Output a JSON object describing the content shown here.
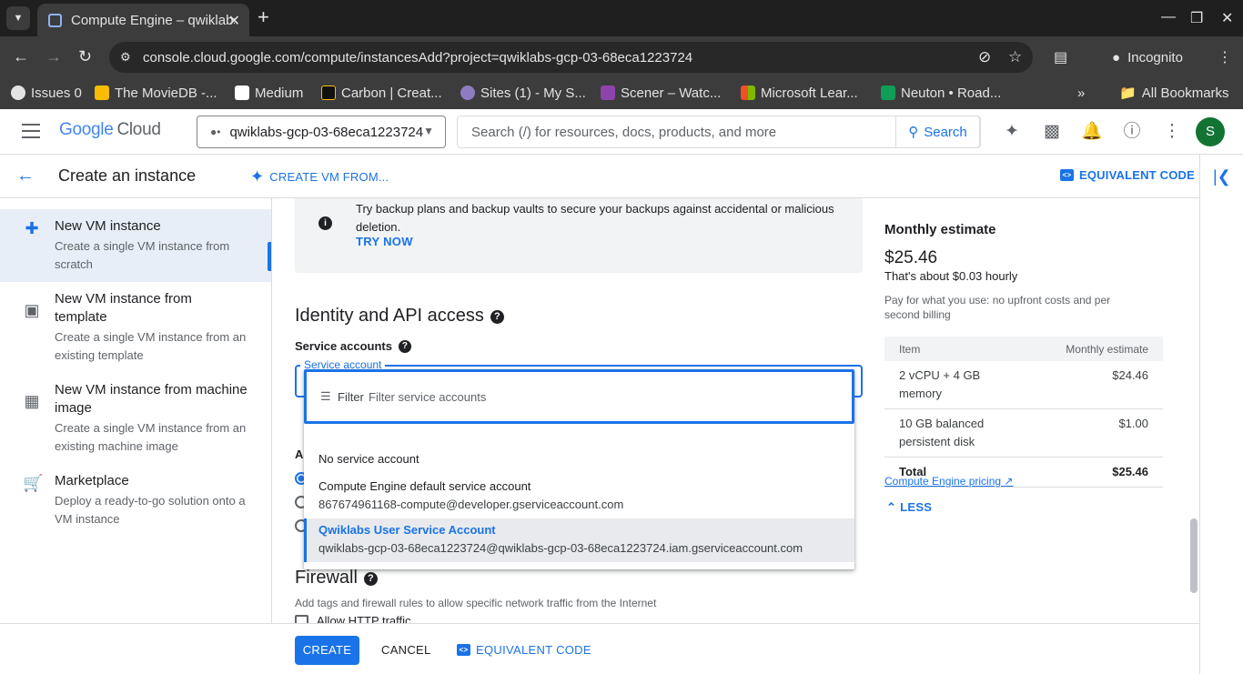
{
  "browser": {
    "tab_title": "Compute Engine – qwiklabs",
    "url": "console.cloud.google.com/compute/instancesAdd?project=qwiklabs-gcp-03-68eca1223724",
    "incognito_label": "Incognito",
    "bookmarks": [
      {
        "label": "Issues 0",
        "color": "#e3e3e3"
      },
      {
        "label": "The MovieDB -...",
        "color": "#fbbc04"
      },
      {
        "label": "Medium",
        "color": "#ffffff"
      },
      {
        "label": "Carbon | Creat...",
        "color": "#222222"
      },
      {
        "label": "Sites (1) - My S...",
        "color": "#8e7cc3"
      },
      {
        "label": "Scener – Watc...",
        "color": "#8e44ad"
      },
      {
        "label": "Microsoft Lear...",
        "color": "#f25022"
      },
      {
        "label": "Neuton • Road...",
        "color": "#0f9d58"
      }
    ],
    "all_bookmarks": "All Bookmarks"
  },
  "header": {
    "logo_google": "Google",
    "logo_cloud": "Cloud",
    "project": "qwiklabs-gcp-03-68eca1223724",
    "search_placeholder": "Search (/) for resources, docs, products, and more",
    "search_button": "Search",
    "avatar_initial": "S"
  },
  "subheader": {
    "title": "Create an instance",
    "create_from": "CREATE VM FROM...",
    "equivalent_code": "EQUIVALENT CODE"
  },
  "nav": [
    {
      "title": "New VM instance",
      "desc": "Create a single VM instance from scratch",
      "icon": "plus-square-icon",
      "active": true
    },
    {
      "title": "New VM instance from template",
      "desc": "Create a single VM instance from an existing template",
      "icon": "template-icon",
      "active": false
    },
    {
      "title": "New VM instance from machine image",
      "desc": "Create a single VM instance from an existing machine image",
      "icon": "machine-image-icon",
      "active": false
    },
    {
      "title": "Marketplace",
      "desc": "Deploy a ready-to-go solution onto a VM instance",
      "icon": "cart-icon",
      "active": false
    }
  ],
  "main": {
    "info_text": "Try backup plans and backup vaults to secure your backups against accidental or malicious deletion.",
    "try_now": "TRY NOW",
    "identity_title": "Identity and API access",
    "service_accounts_label": "Service accounts",
    "service_account_field_label": "Service account",
    "partial_label": "Ac",
    "firewall_title": "Firewall",
    "firewall_desc": "Add tags and firewall rules to allow specific network traffic from the Internet",
    "allow_http": "Allow HTTP traffic"
  },
  "dropdown": {
    "filter_label": "Filter",
    "filter_placeholder": "Filter service accounts",
    "options": [
      {
        "main": "No service account",
        "sub": ""
      },
      {
        "main": "Compute Engine default service account",
        "sub": "867674961168-compute@developer.gserviceaccount.com"
      },
      {
        "main": "Qwiklabs User Service Account",
        "sub": "qwiklabs-gcp-03-68eca1223724@qwiklabs-gcp-03-68eca1223724.iam.gserviceaccount.com",
        "selected": true
      }
    ]
  },
  "estimate": {
    "heading": "Monthly estimate",
    "price": "$25.46",
    "hourly": "That's about $0.03 hourly",
    "note": "Pay for what you use: no upfront costs and per second billing",
    "col_item": "Item",
    "col_estimate": "Monthly estimate",
    "rows": [
      {
        "item": "2 vCPU + 4 GB memory",
        "cost": "$24.46"
      },
      {
        "item": "10 GB balanced persistent disk",
        "cost": "$1.00"
      }
    ],
    "total_label": "Total",
    "total_cost": "$25.46",
    "pricing_link": "Compute Engine pricing",
    "less": "LESS"
  },
  "footer": {
    "create": "CREATE",
    "cancel": "CANCEL",
    "equivalent_code": "EQUIVALENT CODE"
  }
}
